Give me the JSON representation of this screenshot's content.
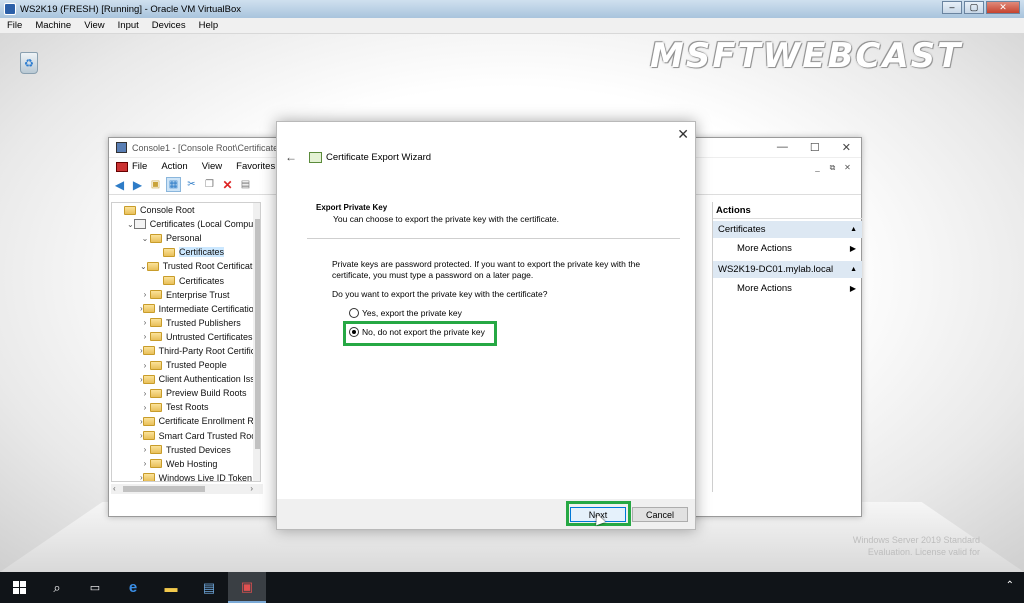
{
  "vbox": {
    "title": "WS2K19 (FRESH) [Running] - Oracle VM VirtualBox",
    "menu": [
      "File",
      "Machine",
      "View",
      "Input",
      "Devices",
      "Help"
    ]
  },
  "desktop": {
    "watermark": "MSFTWEBCAST",
    "activation_line1": "Windows Server 2019 Standard",
    "activation_line2": "Evaluation. License valid for"
  },
  "mmc": {
    "title": "Console1 - [Console Root\\Certificates (Local Computer)\\Personal\\Certificates]",
    "menu": [
      "File",
      "Action",
      "View",
      "Favorites"
    ],
    "tree": [
      {
        "label": "Console Root",
        "indent": 0,
        "exp": "",
        "type": "folder"
      },
      {
        "label": "Certificates (Local Computer)",
        "indent": 1,
        "exp": "⌄",
        "type": "cert"
      },
      {
        "label": "Personal",
        "indent": 2,
        "exp": "⌄",
        "type": "folder"
      },
      {
        "label": "Certificates",
        "indent": 3,
        "exp": "",
        "type": "folder",
        "selected": true
      },
      {
        "label": "Trusted Root Certification Authorities",
        "indent": 2,
        "exp": "⌄",
        "type": "folder"
      },
      {
        "label": "Certificates",
        "indent": 3,
        "exp": "",
        "type": "folder"
      },
      {
        "label": "Enterprise Trust",
        "indent": 2,
        "exp": "›",
        "type": "folder"
      },
      {
        "label": "Intermediate Certification Authorities",
        "indent": 2,
        "exp": "›",
        "type": "folder"
      },
      {
        "label": "Trusted Publishers",
        "indent": 2,
        "exp": "›",
        "type": "folder"
      },
      {
        "label": "Untrusted Certificates",
        "indent": 2,
        "exp": "›",
        "type": "folder"
      },
      {
        "label": "Third-Party Root Certification Authorities",
        "indent": 2,
        "exp": "›",
        "type": "folder"
      },
      {
        "label": "Trusted People",
        "indent": 2,
        "exp": "›",
        "type": "folder"
      },
      {
        "label": "Client Authentication Issuers",
        "indent": 2,
        "exp": "›",
        "type": "folder"
      },
      {
        "label": "Preview Build Roots",
        "indent": 2,
        "exp": "›",
        "type": "folder"
      },
      {
        "label": "Test Roots",
        "indent": 2,
        "exp": "›",
        "type": "folder"
      },
      {
        "label": "Certificate Enrollment Requests",
        "indent": 2,
        "exp": "›",
        "type": "folder"
      },
      {
        "label": "Smart Card Trusted Roots",
        "indent": 2,
        "exp": "›",
        "type": "folder"
      },
      {
        "label": "Trusted Devices",
        "indent": 2,
        "exp": "›",
        "type": "folder"
      },
      {
        "label": "Web Hosting",
        "indent": 2,
        "exp": "›",
        "type": "folder"
      },
      {
        "label": "Windows Live ID Token Issuer",
        "indent": 2,
        "exp": "›",
        "type": "folder"
      }
    ],
    "actions": {
      "header": "Actions",
      "group1": "Certificates",
      "more1": "More Actions",
      "group2": "WS2K19-DC01.mylab.local",
      "more2": "More Actions"
    }
  },
  "wizard": {
    "title": "Certificate Export Wizard",
    "section_title": "Export Private Key",
    "section_sub": "You can choose to export the private key with the certificate.",
    "para": "Private keys are password protected. If you want to export the private key with the certificate, you must type a password on a later page.",
    "question": "Do you want to export the private key with the certificate?",
    "option_yes": "Yes, export the private key",
    "option_no": "No, do not export the private key",
    "selected_option": "no",
    "next_label": "Next",
    "cancel_label": "Cancel",
    "highlight_color": "#26a844"
  }
}
